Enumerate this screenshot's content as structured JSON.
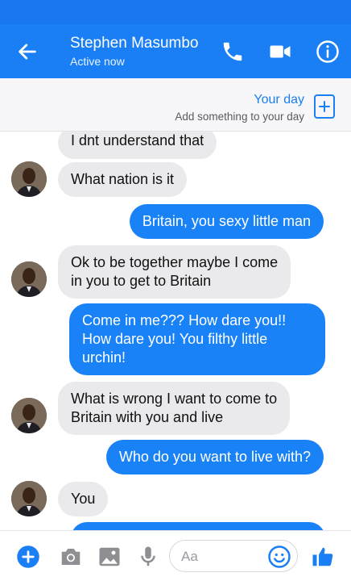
{
  "header": {
    "contact_name": "Stephen Masumbo",
    "contact_status": "Active now"
  },
  "your_day": {
    "title": "Your day",
    "subtitle": "Add something to your day"
  },
  "messages": [
    {
      "from": "contact",
      "text": "I dnt understand that"
    },
    {
      "from": "contact",
      "text": "What nation is it"
    },
    {
      "from": "me",
      "text": "Britain, you sexy little man"
    },
    {
      "from": "contact",
      "text": "Ok to be together maybe I come\nin you to get to Britain"
    },
    {
      "from": "me",
      "text": "Come in me??? How dare you!!\nHow dare you! You filthy little\nurchin!"
    },
    {
      "from": "contact",
      "text": "What is wrong I want to come to\nBritain with you and live"
    },
    {
      "from": "me",
      "text": "Who do you want to live with?"
    },
    {
      "from": "contact",
      "text": "You"
    }
  ],
  "composer": {
    "placeholder": "Aa"
  },
  "colors": {
    "accent": "#1a7ff5",
    "incoming_bubble": "#eaeaed",
    "outgoing_bubble": "#1a82f7"
  },
  "icons": [
    "back-arrow-icon",
    "phone-icon",
    "video-camera-icon",
    "info-icon",
    "add-story-icon",
    "plus-circle-icon",
    "camera-icon",
    "image-icon",
    "microphone-icon",
    "emoji-icon",
    "thumbs-up-icon"
  ]
}
